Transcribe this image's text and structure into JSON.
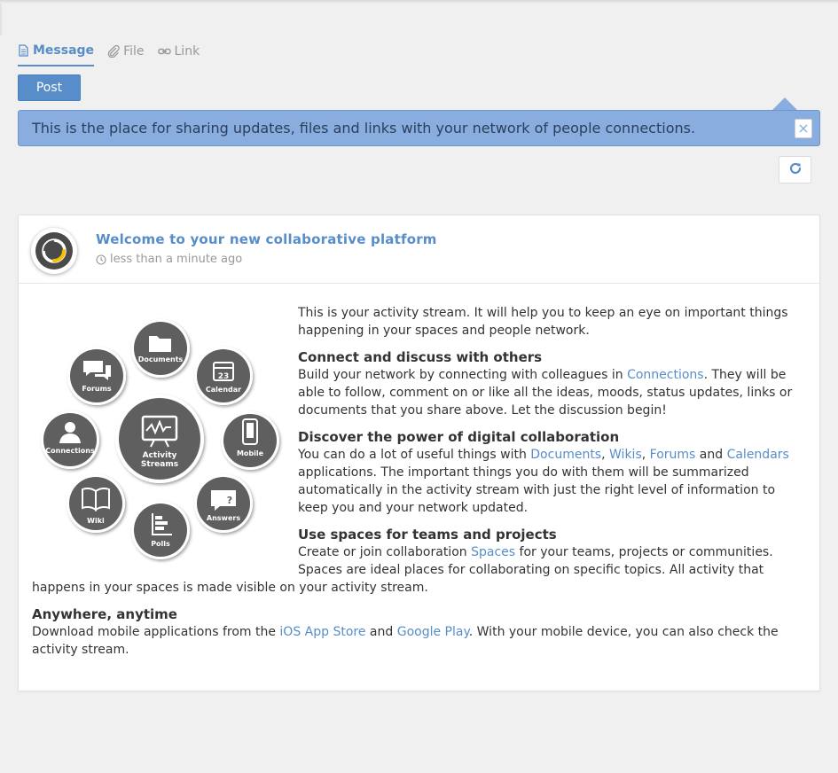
{
  "composer": {
    "tabs": [
      {
        "label": "Message",
        "icon": "document-icon",
        "active": true
      },
      {
        "label": "File",
        "icon": "paperclip-icon",
        "active": false
      },
      {
        "label": "Link",
        "icon": "link-icon",
        "active": false
      }
    ],
    "post_label": "Post"
  },
  "banner": {
    "text": "This is the place for sharing updates, files and links with your network of people connections.",
    "close": "×"
  },
  "activity": {
    "title": "Welcome to your new collaborative platform",
    "time": "less than a minute ago",
    "illustration": {
      "center": [
        "Activity",
        "Streams"
      ],
      "nodes": [
        "Documents",
        "Calendar",
        "Mobile",
        "Answers",
        "Polls",
        "Wiki",
        "Connections",
        "Forums"
      ]
    },
    "intro": "This is your activity stream. It will help you to keep an eye on important things happening in your spaces and people network.",
    "s1": {
      "heading": "Connect and discuss with others",
      "t1": "Build your network by connecting with colleagues in ",
      "link1": "Connections",
      "t2": ". They will be able to follow, comment on or like all the ideas, moods, status updates, links or documents that you share above. Let the discussion begin!"
    },
    "s2": {
      "heading": "Discover the power of digital collaboration",
      "t1": "You can do a lot of useful things with ",
      "link1": "Documents",
      "sep1": ", ",
      "link2": "Wikis",
      "sep2": ", ",
      "link3": "Forums",
      "sep3": " and ",
      "link4": "Calendars",
      "t2": " applications. The important things you do with them will be summarized automatically in the activity stream with just the right level of information to keep you and your network updated."
    },
    "s3": {
      "heading": "Use spaces for teams and projects",
      "t1": "Create or join collaboration ",
      "link1": "Spaces",
      "t2": " for your teams, projects or communities. Spaces are ideal places for collaborating on specific topics. All activity that happens in your spaces is made visible on your activity stream."
    },
    "s4": {
      "heading": "Anywhere, anytime",
      "t1": "Download mobile applications from the ",
      "link1": "iOS App Store",
      "sep1": " and ",
      "link2": "Google Play",
      "t2": ". With your mobile device, you can also check the activity stream."
    }
  },
  "colors": {
    "accent": "#578dc9",
    "banner": "#8aade0",
    "node": "#5f5f5f",
    "avatar_ring": "#f5c000"
  }
}
